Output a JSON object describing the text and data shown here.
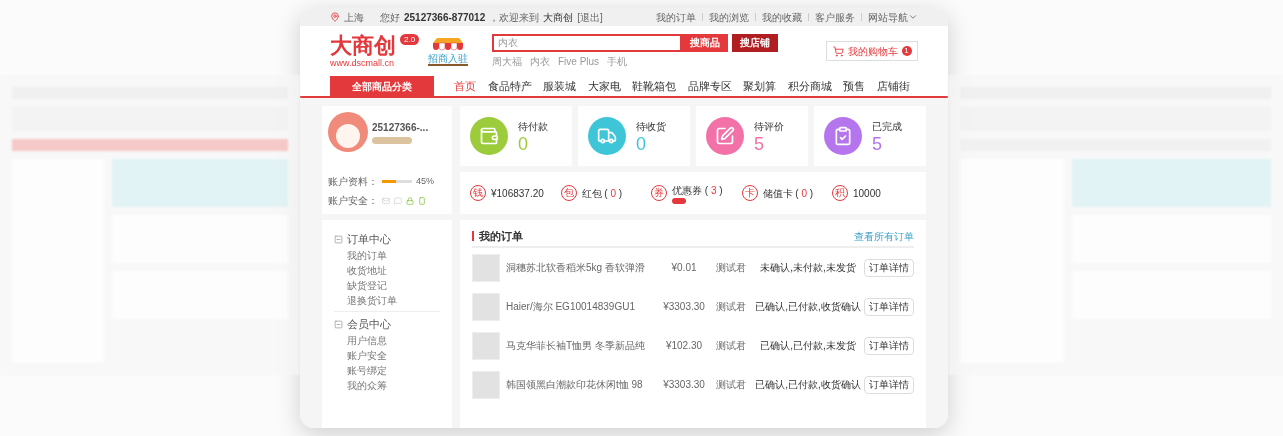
{
  "top_bar": {
    "location": "上海",
    "greeting": "您好",
    "username": "25127366-877012",
    "welcome": "，欢迎来到",
    "site": "大商创",
    "logout": "[退出]",
    "links": [
      "我的订单",
      "我的浏览",
      "我的收藏",
      "客户服务",
      "网站导航"
    ]
  },
  "header": {
    "logo": "大商创",
    "version": "2.0",
    "url": "www.dscmall.cn",
    "merchant_badge": "招商入驻",
    "search": {
      "placeholder": "内衣",
      "buttons": [
        "搜商品",
        "搜店铺"
      ],
      "hot_words": [
        "周大福",
        "内衣",
        "Five Plus",
        "手机"
      ]
    },
    "cart": {
      "label": "我的购物车",
      "count": "1"
    }
  },
  "nav": {
    "category_button": "全部商品分类",
    "items": [
      {
        "label": "首页",
        "selected": true
      },
      {
        "label": "食品特产",
        "selected": false
      },
      {
        "label": "服装城",
        "selected": false
      },
      {
        "label": "大家电",
        "selected": false
      },
      {
        "label": "鞋靴箱包",
        "selected": false
      },
      {
        "label": "品牌专区",
        "selected": false
      },
      {
        "label": "聚划算",
        "selected": false
      },
      {
        "label": "积分商城",
        "selected": false
      },
      {
        "label": "预售",
        "selected": false
      },
      {
        "label": "店铺街",
        "selected": false
      }
    ]
  },
  "profile": {
    "name": "25127366-...",
    "progress_label": "账户资料：",
    "level": 0.45,
    "percent": "45%",
    "security_label": "账户安全："
  },
  "order_stats": [
    {
      "kind": "wallet",
      "label": "待付款",
      "count": "0",
      "color": "#9ccc3c"
    },
    {
      "kind": "truck",
      "label": "待收货",
      "count": "0",
      "color": "#3ec6d8"
    },
    {
      "kind": "review",
      "label": "待评价",
      "count": "5",
      "color": "#f272a8"
    },
    {
      "kind": "done",
      "label": "已完成",
      "count": "5",
      "color": "#b575ec"
    }
  ],
  "assets": [
    {
      "icon_char": "钱",
      "value": "¥106837.20",
      "tag": false
    },
    {
      "icon_char": "包",
      "label": "红包",
      "open": "(",
      "count": "0",
      "close": ")",
      "tag": false
    },
    {
      "icon_char": "券",
      "label": "优惠券",
      "open": "(",
      "count": "3",
      "close": ")",
      "tag": true
    },
    {
      "icon_char": "卡",
      "label": "储值卡",
      "open": "(",
      "count": "0",
      "close": ")",
      "tag": false
    },
    {
      "icon_char": "积",
      "value": "10000",
      "tag": false
    }
  ],
  "sidebar": [
    {
      "title": "订单中心",
      "expanded": true,
      "items": [
        "我的订单",
        "收货地址",
        "缺货登记",
        "退换货订单"
      ]
    },
    {
      "title": "会员中心",
      "expanded": true,
      "items": [
        "用户信息",
        "账户安全",
        "账号绑定",
        "我的众筹"
      ]
    }
  ],
  "orders": {
    "title": "我的订单",
    "view_all": "查看所有订单",
    "rows": [
      {
        "product": "洞穗苏北软香稻米5kg 香软弹滑",
        "price": "¥0.01",
        "buyer": "测试君",
        "status": "未确认,未付款,未发货",
        "action": "订单详情"
      },
      {
        "product": "Haier/海尔 EG10014839GU1",
        "price": "¥3303.30",
        "buyer": "测试君",
        "status": "已确认,已付款,收货确认",
        "action": "订单详情"
      },
      {
        "product": "马克华菲长袖T恤男 冬季新品纯",
        "price": "¥102.30",
        "buyer": "测试君",
        "status": "已确认,已付款,未发货",
        "action": "订单详情"
      },
      {
        "product": "韩国领黑白潮款印花休闲t恤 98",
        "price": "¥3303.30",
        "buyer": "测试君",
        "status": "已确认,已付款,收货确认",
        "action": "订单详情"
      }
    ]
  }
}
